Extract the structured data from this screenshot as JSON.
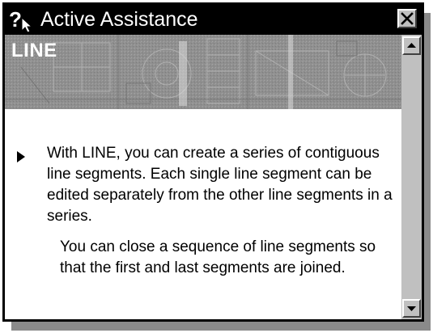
{
  "window": {
    "title": "Active Assistance",
    "title_icon": "help-cursor-icon",
    "close_icon": "close-icon"
  },
  "banner": {
    "heading": "LINE"
  },
  "content": {
    "bullet_icon": "triangle-bullet-icon",
    "paragraph_1": "With LINE, you can create a series of contiguous line segments. Each single line segment can be edited separately from the other line segments in a series.",
    "paragraph_2": "You can close a sequence of line segments so that the first and last segments are joined."
  },
  "scrollbar": {
    "up_icon": "scroll-up-arrow-icon",
    "down_icon": "scroll-down-arrow-icon"
  },
  "colors": {
    "titlebar": "#000000",
    "window_face": "#c0c0c0",
    "banner_bg": "#8f8f8f",
    "text": "#000000"
  }
}
